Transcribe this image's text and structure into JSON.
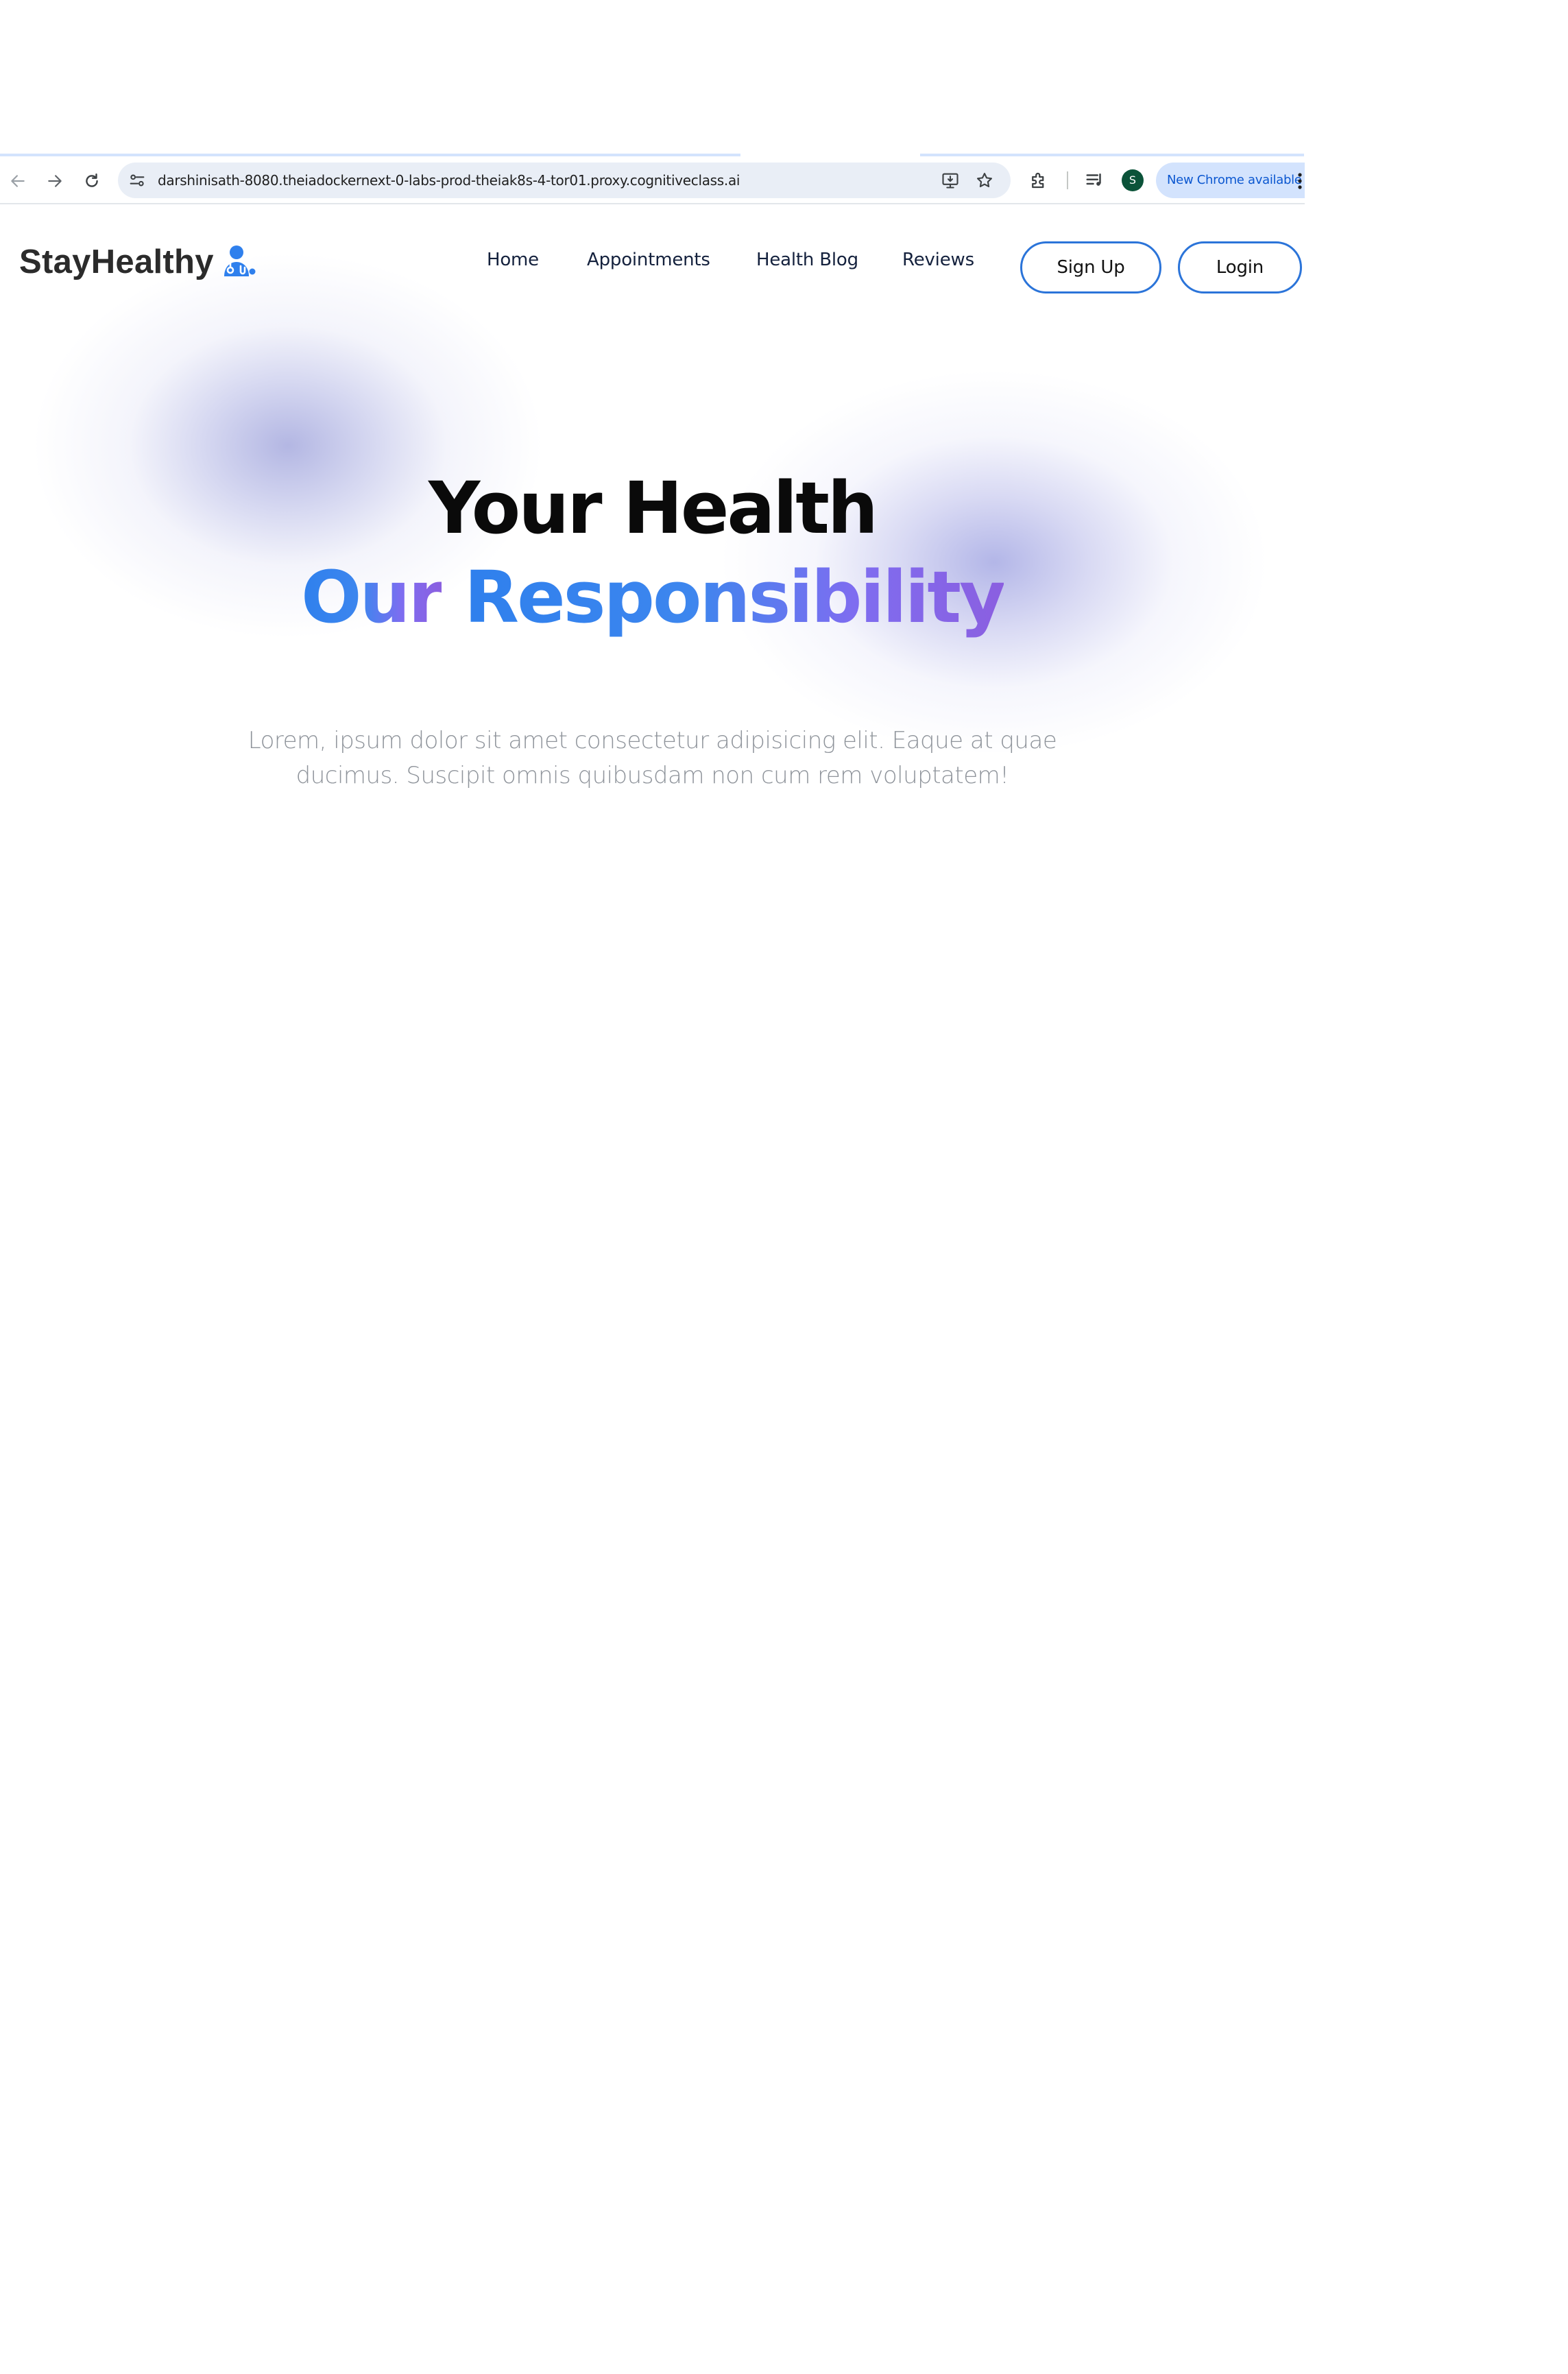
{
  "browser": {
    "url": "darshinisath-8080.theiadockernext-0-labs-prod-theiak8s-4-tor01.proxy.cognitiveclass.ai",
    "profile_initial": "S",
    "update_label": "New Chrome available",
    "icons": {
      "back": "arrow-left-icon",
      "forward": "arrow-right-icon",
      "reload": "reload-icon",
      "site_info": "tune-icon",
      "install": "install-app-icon",
      "bookmark": "star-icon",
      "extensions": "puzzle-icon",
      "media": "playlist-icon",
      "menu": "more-vertical-icon"
    }
  },
  "site": {
    "brand": "StayHealthy",
    "brand_icon": "doctor-icon",
    "nav": [
      "Home",
      "Appointments",
      "Health Blog",
      "Reviews"
    ],
    "signup_label": "Sign Up",
    "login_label": "Login"
  },
  "hero": {
    "line1": "Your Health",
    "line2_word1": "Our",
    "line2_word2": "Responsibility",
    "description": "Lorem, ipsum dolor sit amet consectetur adipisicing elit. Eaque at quae ducimus. Suscipit omnis quibusdam non cum rem voluptatem!"
  },
  "colors": {
    "accent_blue": "#2f80ed",
    "accent_purple": "#8b5fe0",
    "button_border": "#2b74d9",
    "text_dark": "#2b2b2b",
    "text_muted": "#8f949b"
  }
}
